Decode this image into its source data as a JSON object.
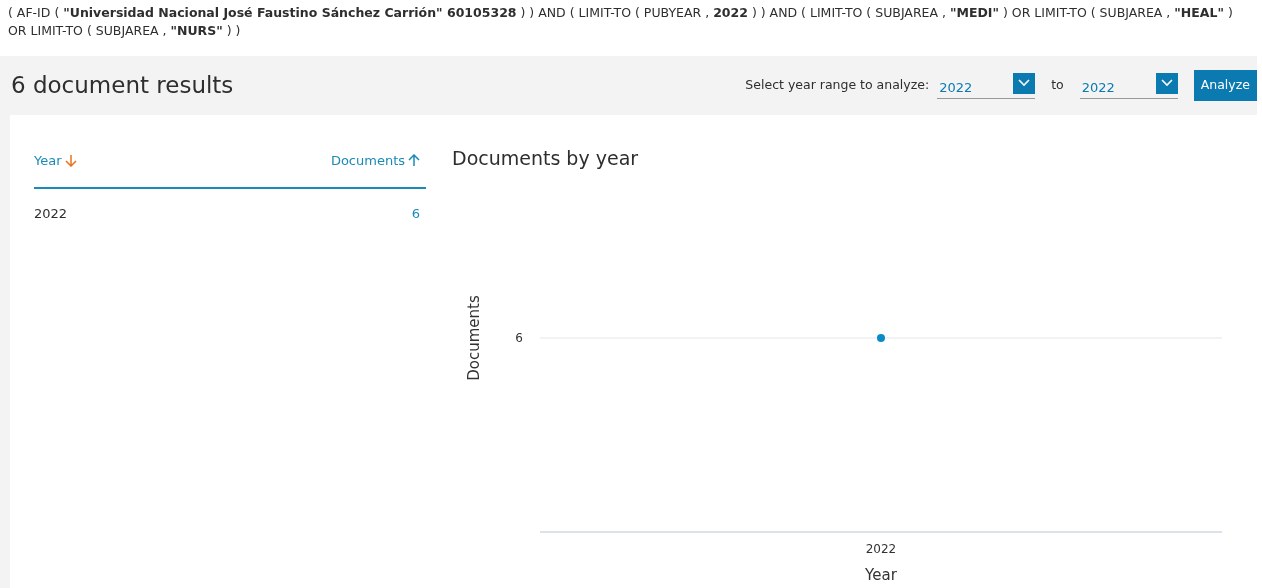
{
  "query": "( AF-ID ( **\"Universidad Nacional José Faustino Sánchez Carrión\"  60105328** ) ) AND ( LIMIT-TO ( PUBYEAR , **2022** ) ) AND ( LIMIT-TO ( SUBJAREA , **\"MEDI\"** ) OR LIMIT-TO ( SUBJAREA , **\"HEAL\"** ) OR LIMIT-TO ( SUBJAREA , **\"NURS\"** ) )",
  "results_title": "6 document results",
  "year_range": {
    "label": "Select year range to analyze:",
    "from": "2022",
    "separator": "to",
    "to": "2022",
    "button": "Analyze"
  },
  "table": {
    "columns": [
      {
        "label": "Year",
        "descending": true,
        "active": true
      },
      {
        "label": "Documents",
        "descending": false,
        "active": false
      }
    ],
    "rows": [
      {
        "year": "2022",
        "documents": "6"
      }
    ]
  },
  "chart": {
    "title": "Documents by year",
    "y_axis_title": "Documents",
    "y_tick_label": "6",
    "x_tick_label": "2022",
    "x_axis_title": "Year"
  }
}
